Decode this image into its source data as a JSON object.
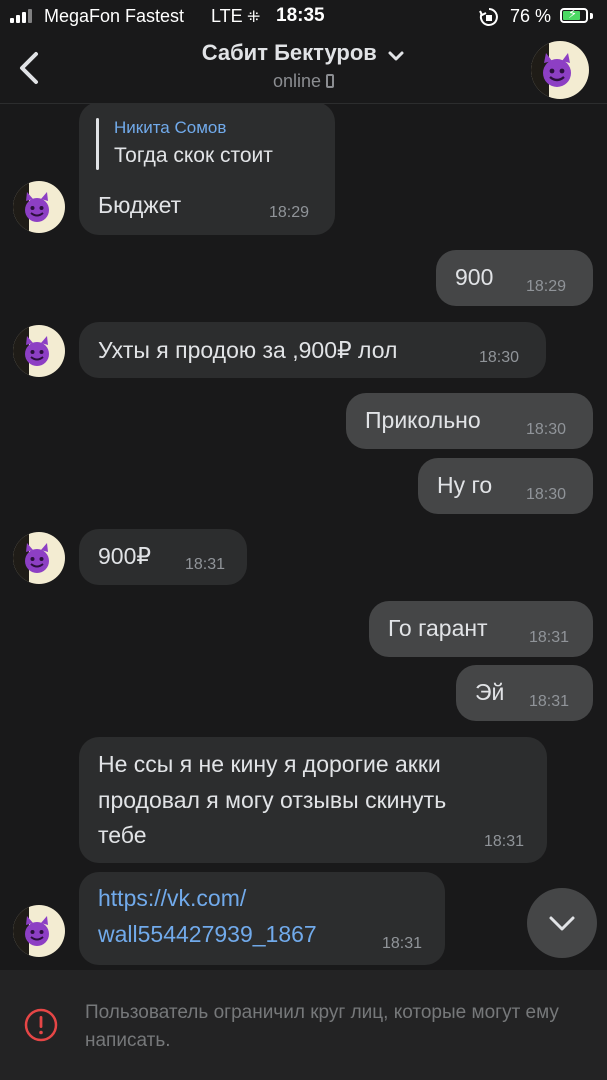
{
  "status_bar": {
    "carrier": "MegaFon Fastest",
    "network": "LTE",
    "time": "18:35",
    "battery": "76 %",
    "battery_level": 0.76,
    "battery_color": "#4cd964"
  },
  "header": {
    "title": "Сабит Бектуров",
    "subtitle": "online",
    "icons": [
      "back-chevron-icon",
      "chevron-down-icon",
      "phone-icon",
      "avatar-devil-emoji"
    ]
  },
  "colors": {
    "background": "#19191a",
    "incoming_bubble": "#2c2d2e",
    "outgoing_bubble": "#454647",
    "link": "#71aaeb",
    "time": "#909499"
  },
  "messages": [
    {
      "dir": "in",
      "reply_name": "Никита Сомов",
      "reply_text": "Тогда скок стоит",
      "text": "Бюджет",
      "time": "18:29"
    },
    {
      "dir": "out",
      "text": "900",
      "time": "18:29"
    },
    {
      "dir": "in",
      "text": "Ухты я продою за ,900₽ лол",
      "time": "18:30"
    },
    {
      "dir": "out",
      "text": "Прикольно",
      "time": "18:30"
    },
    {
      "dir": "out",
      "text": "Ну го",
      "time": "18:30"
    },
    {
      "dir": "in",
      "text": "900₽",
      "time": "18:31"
    },
    {
      "dir": "out",
      "text": "Го гарант",
      "time": "18:31"
    },
    {
      "dir": "out",
      "text": "Эй",
      "time": "18:31"
    },
    {
      "dir": "in",
      "lines": [
        "Не ссы я не кину я дорогие акки",
        "продовал я могу отзывы скинуть",
        "тебе"
      ],
      "time": "18:31"
    },
    {
      "dir": "in",
      "link_lines": [
        "https://vk.com/",
        "wall554427939_1867"
      ],
      "time": "18:31"
    }
  ],
  "footer": {
    "notice": "Пользователь ограничил круг лиц, которые могут ему написать."
  }
}
